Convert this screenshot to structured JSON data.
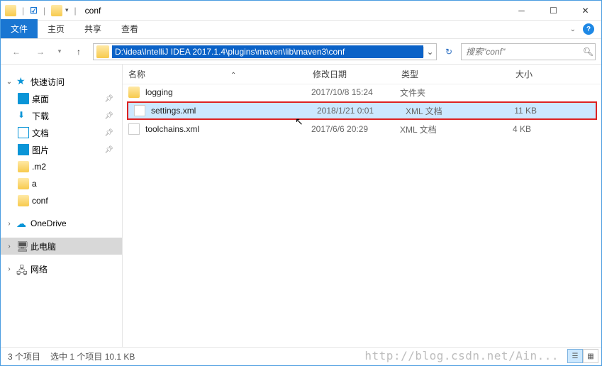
{
  "window": {
    "title": "conf"
  },
  "tabs": {
    "file": "文件",
    "home": "主页",
    "share": "共享",
    "view": "查看"
  },
  "address": {
    "path": "D:\\idea\\IntelliJ IDEA 2017.1.4\\plugins\\maven\\lib\\maven3\\conf",
    "search_placeholder": "搜索\"conf\""
  },
  "nav": {
    "quick": "快速访问",
    "desktop": "桌面",
    "downloads": "下载",
    "documents": "文档",
    "pictures": "图片",
    "m2": ".m2",
    "a": "a",
    "conf": "conf",
    "onedrive": "OneDrive",
    "thispc": "此电脑",
    "network": "网络"
  },
  "columns": {
    "name": "名称",
    "date": "修改日期",
    "type": "类型",
    "size": "大小"
  },
  "files": [
    {
      "name": "logging",
      "date": "2017/10/8 15:24",
      "type": "文件夹",
      "size": "",
      "kind": "folder"
    },
    {
      "name": "settings.xml",
      "date": "2018/1/21 0:01",
      "type": "XML 文档",
      "size": "11 KB",
      "kind": "file",
      "selected": true
    },
    {
      "name": "toolchains.xml",
      "date": "2017/6/6 20:29",
      "type": "XML 文档",
      "size": "4 KB",
      "kind": "file"
    }
  ],
  "status": {
    "items": "3 个项目",
    "selected": "选中 1 个项目  10.1 KB"
  },
  "watermark": "http://blog.csdn.net/Ain..."
}
